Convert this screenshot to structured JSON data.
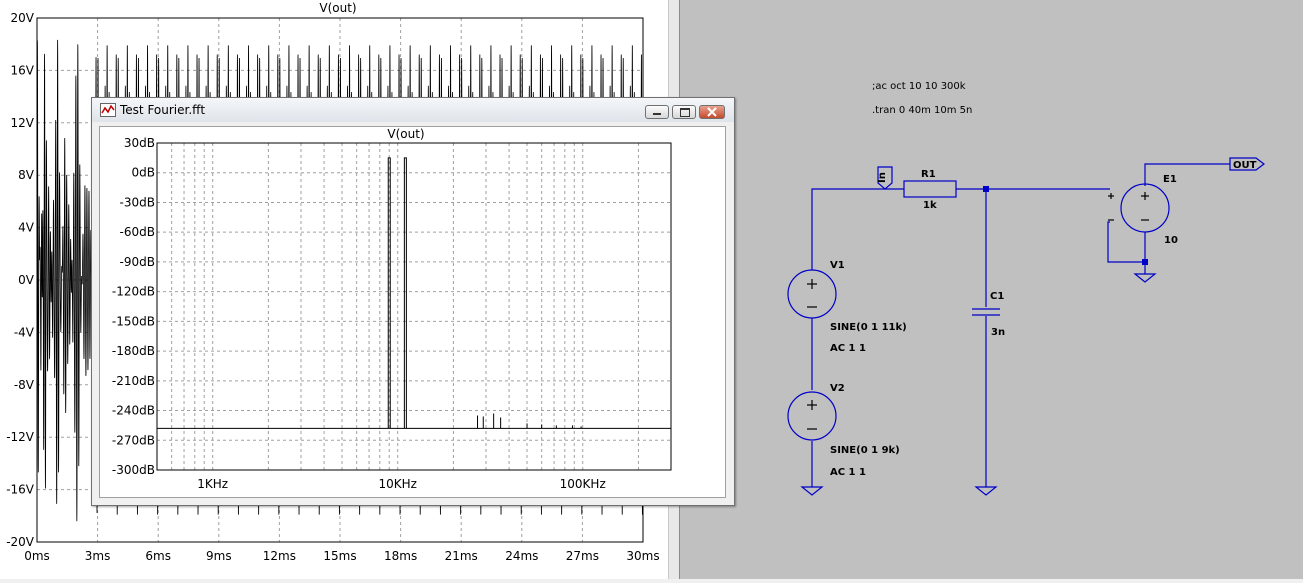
{
  "main_plot": {
    "title": "V(out)",
    "y_ticks": [
      "20V",
      "16V",
      "12V",
      "8V",
      "4V",
      "0V",
      "-4V",
      "-8V",
      "-12V",
      "-16V",
      "-20V"
    ],
    "x_ticks": [
      "0ms",
      "3ms",
      "6ms",
      "9ms",
      "12ms",
      "15ms",
      "18ms",
      "21ms",
      "24ms",
      "27ms",
      "30ms"
    ]
  },
  "fft_window": {
    "title": "Test Fourier.fft",
    "plot_title": "V(out)",
    "y_ticks": [
      "30dB",
      "0dB",
      "-30dB",
      "-60dB",
      "-90dB",
      "-120dB",
      "-150dB",
      "-180dB",
      "-210dB",
      "-240dB",
      "-270dB",
      "-300dB"
    ],
    "x_ticks": [
      "1KHz",
      "10KHz",
      "100KHz"
    ]
  },
  "schematic": {
    "directives": [
      ";ac oct 10 10 300k",
      ".tran 0 40m 10m 5n"
    ],
    "net_in": "In",
    "net_out": "OUT",
    "r1": {
      "name": "R1",
      "value": "1k"
    },
    "c1": {
      "name": "C1",
      "value": "3n"
    },
    "e1": {
      "name": "E1",
      "value": "10"
    },
    "v1": {
      "name": "V1",
      "source": "SINE(0 1 11k)",
      "ac": "AC 1 1"
    },
    "v2": {
      "name": "V2",
      "source": "SINE(0 1 9k)",
      "ac": "AC 1 1"
    }
  },
  "chart_data": [
    {
      "type": "line",
      "title": "V(out)",
      "xlabel": "",
      "ylabel": "",
      "xlim": [
        0,
        30
      ],
      "ylim": [
        -20,
        20
      ],
      "x_unit": "ms",
      "y_unit": "V",
      "grid": true,
      "series": [
        {
          "description_free": true,
          "values": "dense beat waveform between approx -18V and 18V; irregular at start, settling by ~3ms"
        }
      ]
    },
    {
      "type": "line",
      "title": "V(out)",
      "xlim": [
        500,
        300000
      ],
      "x_scale": "log",
      "x_unit": "Hz",
      "ylim": [
        -300,
        30
      ],
      "y_unit": "dB",
      "grid": true,
      "series": [
        {
          "peaks": [
            {
              "x": 9000,
              "y": 15
            },
            {
              "x": 11000,
              "y": 15
            }
          ],
          "floor": -258
        }
      ]
    }
  ]
}
